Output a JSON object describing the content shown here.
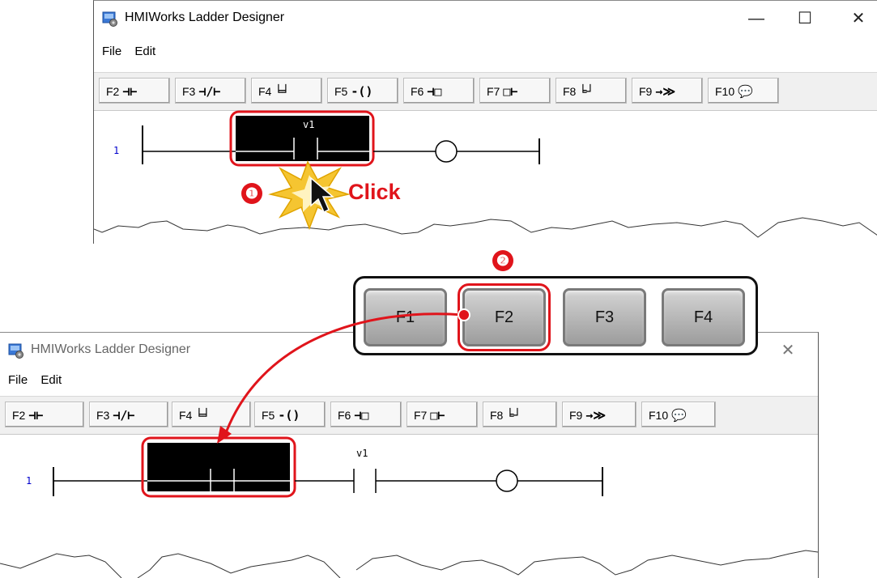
{
  "top_window": {
    "title": "HMIWorks Ladder Designer",
    "controls": {
      "minimize": "—",
      "maximize": "☐",
      "close": "✕"
    },
    "menu": [
      "File",
      "Edit"
    ],
    "toolbar": [
      {
        "key": "F2",
        "icon": "⊣⊢"
      },
      {
        "key": "F3",
        "icon": "⊣/⊢"
      },
      {
        "key": "F4",
        "icon": "╘╛"
      },
      {
        "key": "F5",
        "icon": "-()"
      },
      {
        "key": "F6",
        "icon": "⊣□"
      },
      {
        "key": "F7",
        "icon": "□⊢"
      },
      {
        "key": "F8",
        "icon": "╘┘"
      },
      {
        "key": "F9",
        "icon": "→≫"
      },
      {
        "key": "F10",
        "icon": "💬"
      }
    ],
    "rung_number": "1",
    "contact_label": "v1"
  },
  "bottom_window": {
    "title": "HMIWorks Ladder Designer",
    "controls": {
      "close": "✕"
    },
    "menu": [
      "File",
      "Edit"
    ],
    "toolbar": [
      {
        "key": "F2",
        "icon": "⊣⊢"
      },
      {
        "key": "F3",
        "icon": "⊣/⊢"
      },
      {
        "key": "F4",
        "icon": "╘╛"
      },
      {
        "key": "F5",
        "icon": "-()"
      },
      {
        "key": "F6",
        "icon": "⊣□"
      },
      {
        "key": "F7",
        "icon": "□⊢"
      },
      {
        "key": "F8",
        "icon": "╘┘"
      },
      {
        "key": "F9",
        "icon": "→≫"
      },
      {
        "key": "F10",
        "icon": "💬"
      }
    ],
    "rung_number": "1",
    "contact_label": "v1"
  },
  "keyboard": {
    "keys": [
      "F1",
      "F2",
      "F3",
      "F4"
    ],
    "highlighted": "F2"
  },
  "annotations": {
    "step1": "❶",
    "step2": "❷",
    "click_text": "Click"
  },
  "colors": {
    "accent": "#e0141b",
    "rung_number": "#0000cc",
    "toolbar_bg": "#f0f0f0"
  }
}
